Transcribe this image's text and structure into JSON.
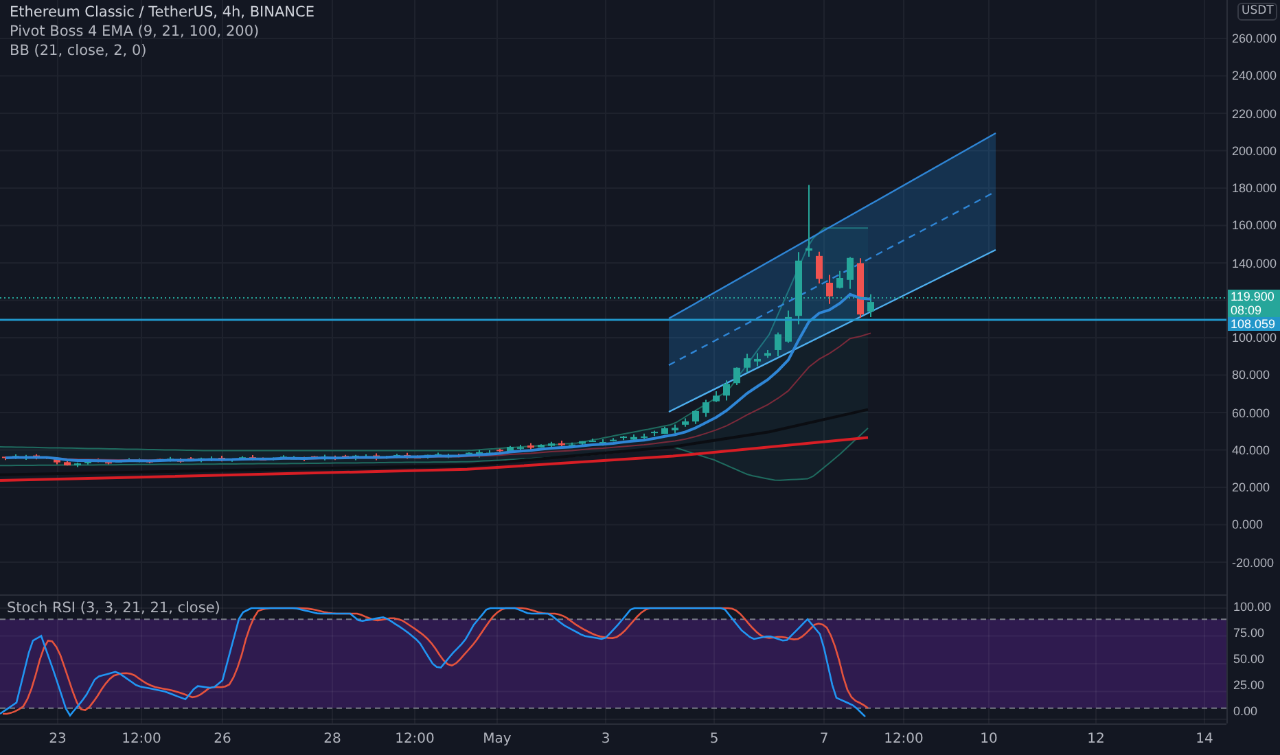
{
  "legend": {
    "symbol": "Ethereum Classic / TetherUS, 4h, BINANCE",
    "indicators": [
      "Pivot Boss 4 EMA (9, 21, 100, 200)",
      "BB (21, close, 2, 0)"
    ]
  },
  "price_axis": {
    "currency": "USDT",
    "upper_ticks": [
      "260.000",
      "240.000",
      "220.000",
      "200.000",
      "180.000",
      "160.000",
      "140.000"
    ],
    "lower_ticks": [
      "100.000",
      "80.000",
      "60.000",
      "40.000",
      "20.000",
      "0.000",
      "-20.000"
    ],
    "last_price": "119.900",
    "countdown": "08:09",
    "line_price": "108.059"
  },
  "stoch_rsi": {
    "title": "Stoch RSI (3, 3, 21, 21, close)",
    "ticks": [
      "100.00",
      "75.00",
      "50.00",
      "25.00",
      "0.00"
    ]
  },
  "time_axis": {
    "ticks": [
      "23",
      "12:00",
      "26",
      "28",
      "12:00",
      "May",
      "3",
      "5",
      "7",
      "12:00",
      "10",
      "12",
      "14"
    ]
  }
}
